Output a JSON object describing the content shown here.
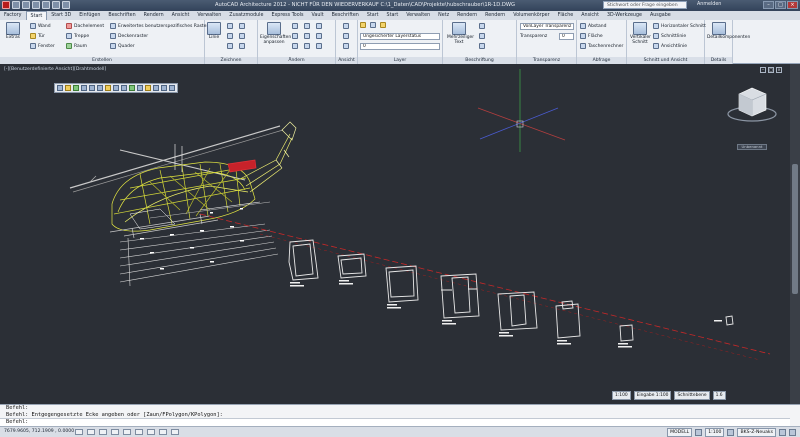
{
  "titlebar": {
    "title": "AutoCAD Architecture 2012 - NICHT FÜR DEN WIEDERVERKAUF   C:\\1_Daten\\CAD\\Projekte\\hubschrauber\\1R-1D.DWG",
    "search_placeholder": "Stichwort oder Frage eingeben",
    "signin": "Anmelden"
  },
  "tabs": [
    "Factory",
    "Start",
    "Start 3D",
    "Einfügen",
    "Beschriften",
    "Rendern",
    "Ansicht",
    "Verwalten",
    "Zusatzmodule",
    "Express Tools",
    "Vault",
    "Beschriften",
    "Start",
    "Start",
    "Verwalten",
    "Netz",
    "Rendern",
    "Rendern",
    "Volumenkörper",
    "Fläche",
    "Ansicht",
    "3D-Werkzeuge",
    "Ausgabe"
  ],
  "active_tab_index": 1,
  "ribbon": {
    "erstellen": {
      "title": "Erstellen",
      "big_button": "Extras",
      "items": [
        "Wand",
        "Tür",
        "Fenster",
        "Dachelement",
        "Treppe",
        "Raum",
        "Erweitertes benutzerspezifisches Raster",
        "Deckenraster",
        "Quader"
      ]
    },
    "zeichnen": {
      "title": "Zeichnen",
      "big_button": "Linie"
    },
    "aendern": {
      "title": "Ändern",
      "big_button": "Eigenschaften anpassen"
    },
    "ansicht": {
      "title": "Ansicht"
    },
    "layer": {
      "title": "Layer",
      "layer_state": "Ungesicherter Layerstatus",
      "current_layer": "0"
    },
    "beschriftung": {
      "title": "Beschriftung",
      "big_button": "Mehrzeiliger Text"
    },
    "transparenz": {
      "title": "Transparenz",
      "layer_transparency": "VonLayer Transparenz",
      "transparency_label": "Transparenz",
      "transparency_value": "0"
    },
    "abfrage": {
      "title": "Abfrage",
      "items": [
        "Abstand",
        "Fläche",
        "Taschenrechner"
      ]
    },
    "schnitt": {
      "title": "Schnitt und Ansicht",
      "big_button": "Vertikaler Schnitt",
      "items": [
        "Horizontaler Schnitt",
        "Schnittlinie",
        "Ansichtlinie"
      ]
    },
    "details": {
      "title": "Details",
      "big_button": "Detailkomponenten"
    }
  },
  "viewport": {
    "label": "[-][Benutzerdefinierte Ansicht][Drahtmodell]",
    "viewcube_label": "Unbenannt",
    "scale": "1:100",
    "input_scale": "Eingabe 1:100",
    "detail_level": "Schnittebene",
    "detail_value": "1.6"
  },
  "command": {
    "history": [
      "Befehl:",
      "Befehl: Entgegengesetzte Ecke angeben oder [Zaun/FPolygon/KPolygon]:"
    ],
    "prompt": "Befehl:"
  },
  "status": {
    "coords": "7679.9605, 712.1909 , 0.0000",
    "model": "MODELL",
    "scale_chip": "1:100",
    "style": "BKS-Z-Neuaks"
  }
}
